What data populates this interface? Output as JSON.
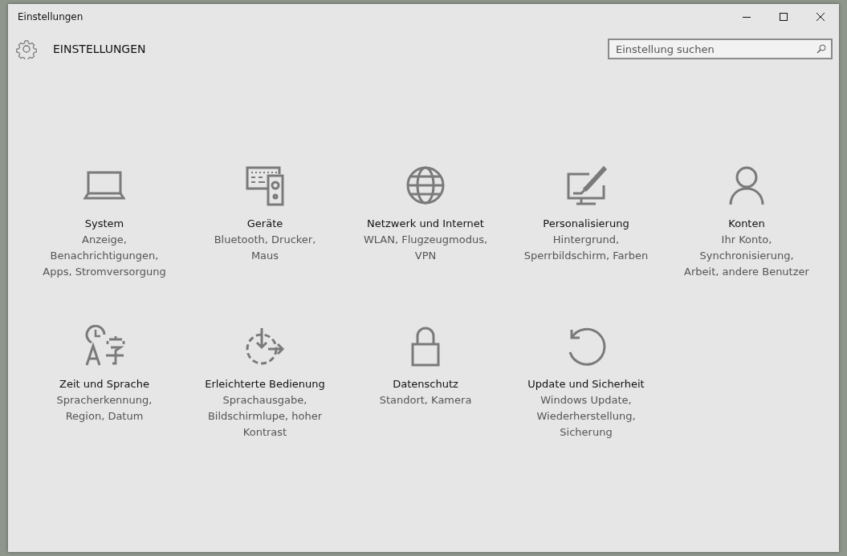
{
  "window": {
    "title": "Einstellungen"
  },
  "header": {
    "title": "EINSTELLUNGEN"
  },
  "search": {
    "placeholder": "Einstellung suchen"
  },
  "categories": [
    {
      "kind": "system",
      "title": "System",
      "description": [
        "Anzeige,",
        "Benachrichtigungen,",
        "Apps, Stromversorgung"
      ]
    },
    {
      "kind": "devices",
      "title": "Geräte",
      "description": [
        "Bluetooth, Drucker,",
        "Maus"
      ]
    },
    {
      "kind": "network",
      "title": "Netzwerk und Internet",
      "description": [
        "WLAN, Flugzeugmodus,",
        "VPN"
      ]
    },
    {
      "kind": "personalization",
      "title": "Personalisierung",
      "description": [
        "Hintergrund,",
        "Sperrbildschirm, Farben"
      ]
    },
    {
      "kind": "accounts",
      "title": "Konten",
      "description": [
        "Ihr Konto,",
        "Synchronisierung,",
        "Arbeit, andere Benutzer"
      ]
    },
    {
      "kind": "time",
      "title": "Zeit und Sprache",
      "description": [
        "Spracherkennung,",
        "Region, Datum"
      ]
    },
    {
      "kind": "ease",
      "title": "Erleichterte Bedienung",
      "description": [
        "Sprachausgabe,",
        "Bildschirmlupe, hoher",
        "Kontrast"
      ]
    },
    {
      "kind": "privacy",
      "title": "Datenschutz",
      "description": [
        "Standort, Kamera"
      ]
    },
    {
      "kind": "update",
      "title": "Update und Sicherheit",
      "description": [
        "Windows Update,",
        "Wiederherstellung,",
        "Sicherung"
      ]
    }
  ]
}
